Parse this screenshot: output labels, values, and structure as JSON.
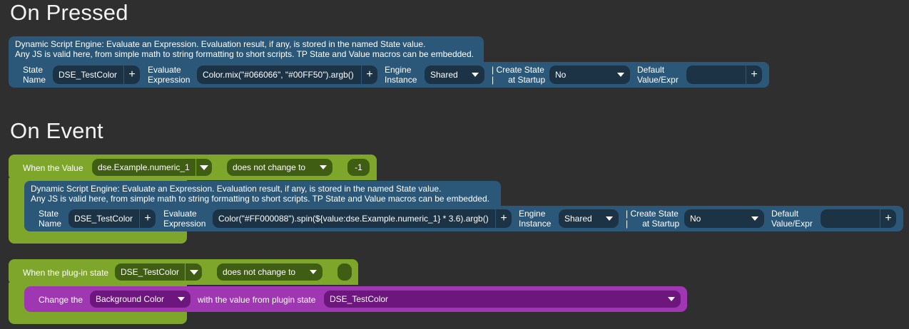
{
  "on_pressed": {
    "title": "On Pressed",
    "info_line1": "Dynamic Script Engine: Evaluate an Expression. Evaluation result, if any, is stored in the named State value.",
    "info_line2": "Any JS is valid here, from simple math to string formatting to short scripts. TP State and Value macros can be embedded.",
    "state_name_label_1": "State",
    "state_name_label_2": "Name",
    "state_name_value": "DSE_TestColor",
    "evaluate_label_1": "Evaluate",
    "evaluate_label_2": "Expression",
    "expression_value": "Color.mix(\"#066066\", \"#00FF50\").argb()",
    "engine_label_1": "Engine",
    "engine_label_2": "Instance",
    "engine_value": "Shared",
    "create_label_1": "| Create State",
    "create_label_2": "|      at Startup",
    "create_value": "No",
    "default_label_1": "Default",
    "default_label_2": "Value/Expr",
    "default_value": "",
    "plus": "+"
  },
  "on_event": {
    "title": "On Event",
    "event1": {
      "when_label": "When the Value",
      "value_source": "dse.Example.numeric_1",
      "condition": "does not change to",
      "compare_value": "-1",
      "action": {
        "info_line1": "Dynamic Script Engine: Evaluate an Expression. Evaluation result, if any, is stored in the named State value.",
        "info_line2": "Any JS is valid here, from simple math to string formatting to short scripts. TP State and Value macros can be embedded.",
        "state_name_label_1": "State",
        "state_name_label_2": "Name",
        "state_name_value": "DSE_TestColor",
        "evaluate_label_1": "Evaluate",
        "evaluate_label_2": "Expression",
        "expression_value": "Color(\"#FF000088\").spin(${value:dse.Example.numeric_1} * 3.6).argb()",
        "engine_label_1": "Engine",
        "engine_label_2": "Instance",
        "engine_value": "Shared",
        "create_label_1": "| Create State",
        "create_label_2": "|      at Startup",
        "create_value": "No",
        "default_label_1": "Default",
        "default_label_2": "Value/Expr",
        "default_value": ""
      }
    },
    "event2": {
      "when_label": "When the plug-in state",
      "state_source": "DSE_TestColor",
      "condition": "does not change to",
      "compare_value": "",
      "action": {
        "change_label": "Change the",
        "property": "Background Color",
        "with_label": "with the value from plugin state",
        "source_state": "DSE_TestColor"
      }
    }
  },
  "colors": {
    "background": "#2f2f2f",
    "blue_block": "#2b5879",
    "blue_field": "#1c3346",
    "green_block": "#7ea62a",
    "green_field": "#405d14",
    "purple_block": "#9f37b3",
    "purple_field": "#6d167e"
  },
  "icons": [
    "plus-icon",
    "caret-down-icon",
    "dropdown-arrow-icon"
  ]
}
